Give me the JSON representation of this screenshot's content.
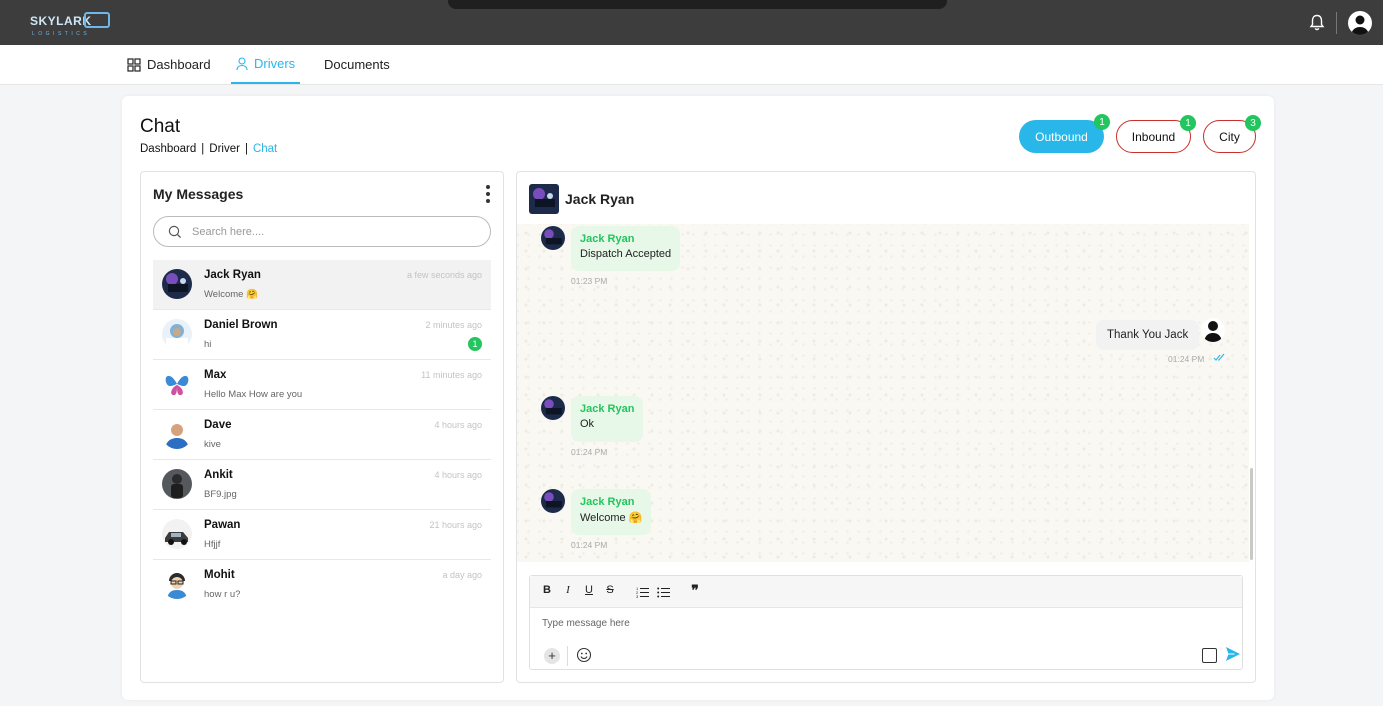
{
  "app": {
    "logo_text": "SKYLARK",
    "logo_sub": "LOGISTICS"
  },
  "colors": {
    "accent": "#29b6e8",
    "badge": "#22c55e",
    "inbound_border": "#c9302c",
    "topbar": "#3d3d3d"
  },
  "nav": [
    {
      "label": "Dashboard",
      "icon": "grid-icon"
    },
    {
      "label": "Drivers",
      "icon": "person-icon",
      "active": true
    },
    {
      "label": "Documents"
    }
  ],
  "page": {
    "title": "Chat",
    "breadcrumb": [
      "Dashboard",
      "Driver",
      "Chat"
    ],
    "filters": [
      {
        "label": "Outbound",
        "count": "1",
        "active": true
      },
      {
        "label": "Inbound",
        "count": "1"
      },
      {
        "label": "City",
        "count": "3"
      }
    ]
  },
  "messages_panel": {
    "title": "My Messages",
    "search_placeholder": "Search here....",
    "conversations": [
      {
        "name": "Jack Ryan",
        "preview": "Welcome 🤗",
        "time": "a few seconds ago",
        "selected": true
      },
      {
        "name": "Daniel Brown",
        "preview": "hi",
        "time": "2 minutes ago",
        "unread": "1"
      },
      {
        "name": "Max",
        "preview": "Hello Max How are you",
        "time": "11 minutes ago"
      },
      {
        "name": "Dave",
        "preview": "kive",
        "time": "4 hours ago"
      },
      {
        "name": "Ankit",
        "preview": "BF9.jpg",
        "time": "4 hours ago"
      },
      {
        "name": "Pawan",
        "preview": "Hfjjf",
        "time": "21 hours ago"
      },
      {
        "name": "Mohit",
        "preview": "how r u?",
        "time": "a day ago"
      }
    ]
  },
  "chat": {
    "contact": "Jack Ryan",
    "messages": [
      {
        "from": "Jack Ryan",
        "text": "Dispatch Accepted",
        "time": "01:23 PM",
        "direction": "in"
      },
      {
        "text": "Thank You Jack",
        "time": "01:24 PM",
        "direction": "out"
      },
      {
        "from": "Jack Ryan",
        "text": "Ok",
        "time": "01:24 PM",
        "direction": "in"
      },
      {
        "from": "Jack Ryan",
        "text": "Welcome 🤗",
        "time": "01:24 PM",
        "direction": "in"
      }
    ],
    "toolbar": {
      "bold": "B",
      "italic": "I",
      "underline": "U",
      "strike": "S",
      "quote": "❞"
    },
    "input_placeholder": "Type message here"
  }
}
